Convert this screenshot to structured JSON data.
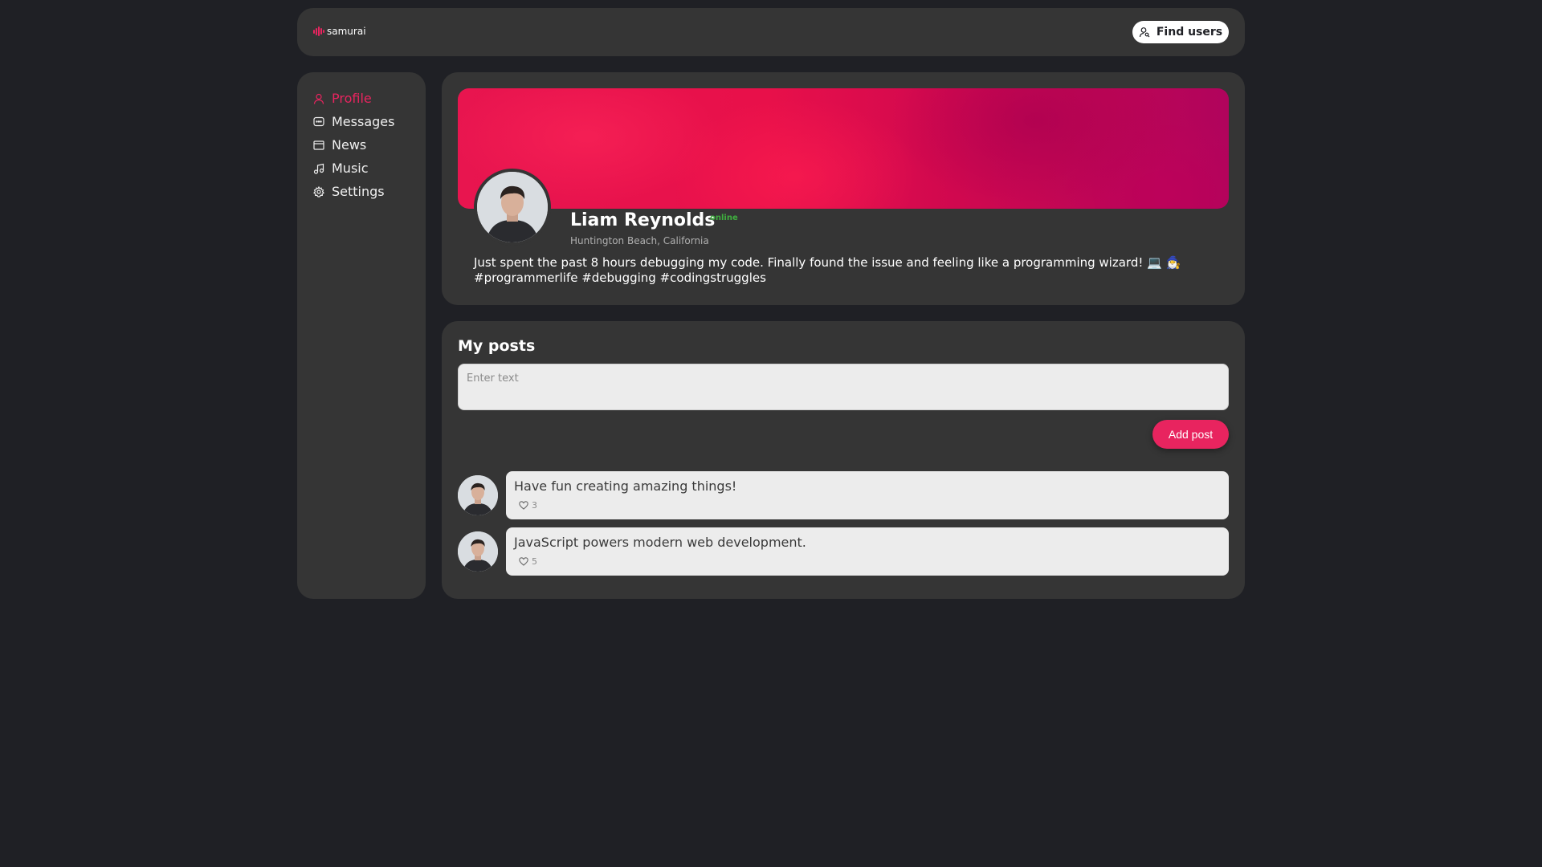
{
  "header": {
    "logo_text": "samurai",
    "find_users_label": "Find users"
  },
  "sidebar": {
    "items": [
      {
        "label": "Profile",
        "icon": "user-icon",
        "active": true
      },
      {
        "label": "Messages",
        "icon": "message-icon",
        "active": false
      },
      {
        "label": "News",
        "icon": "news-icon",
        "active": false
      },
      {
        "label": "Music",
        "icon": "music-icon",
        "active": false
      },
      {
        "label": "Settings",
        "icon": "gear-icon",
        "active": false
      }
    ]
  },
  "profile": {
    "name": "Liam Reynolds",
    "online_label": "online",
    "location": "Huntington Beach, California",
    "status": "Just spent the past 8 hours debugging my code. Finally found the issue and feeling like a programming wizard! 💻 🧙‍♂️ #programmerlife #debugging #codingstruggles"
  },
  "posts": {
    "title": "My posts",
    "input_placeholder": "Enter text",
    "add_post_label": "Add post",
    "items": [
      {
        "text": "Have fun creating amazing things!",
        "likes": "3"
      },
      {
        "text": "JavaScript powers modern web development.",
        "likes": "5"
      }
    ]
  },
  "colors": {
    "accent": "#e8245f",
    "background": "#1f2025",
    "card": "#353535",
    "online": "#3fae3f"
  }
}
